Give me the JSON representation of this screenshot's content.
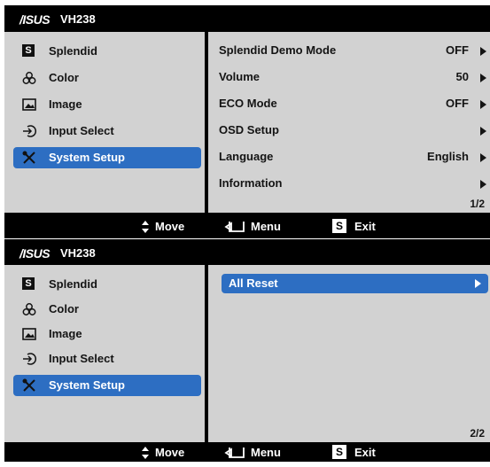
{
  "osd": [
    {
      "brand": "/ISUS",
      "model": "VH238",
      "sidebar": [
        {
          "label": "Splendid",
          "icon": "splendid-s-icon"
        },
        {
          "label": "Color",
          "icon": "color-circles-icon"
        },
        {
          "label": "Image",
          "icon": "image-icon"
        },
        {
          "label": "Input Select",
          "icon": "input-arrow-icon"
        },
        {
          "label": "System Setup",
          "icon": "wrench-screwdriver-icon",
          "selected": true
        }
      ],
      "rows": [
        {
          "label": "Splendid Demo Mode",
          "value": "OFF"
        },
        {
          "label": "Volume",
          "value": "50"
        },
        {
          "label": "ECO Mode",
          "value": "OFF"
        },
        {
          "label": "OSD Setup",
          "value": ""
        },
        {
          "label": "Language",
          "value": "English"
        },
        {
          "label": "Information",
          "value": ""
        }
      ],
      "page": "1/2",
      "footer": {
        "move": "Move",
        "menu": "Menu",
        "exit": "Exit",
        "exit_icon_letter": "S"
      }
    },
    {
      "brand": "/ISUS",
      "model": "VH238",
      "sidebar": [
        {
          "label": "Splendid",
          "icon": "splendid-s-icon"
        },
        {
          "label": "Color",
          "icon": "color-circles-icon"
        },
        {
          "label": "Image",
          "icon": "image-icon"
        },
        {
          "label": "Input Select",
          "icon": "input-arrow-icon"
        },
        {
          "label": "System Setup",
          "icon": "wrench-screwdriver-icon",
          "selected": true
        }
      ],
      "rows": [
        {
          "label": "All Reset",
          "value": "",
          "selected": true
        }
      ],
      "page": "2/2",
      "footer": {
        "move": "Move",
        "menu": "Menu",
        "exit": "Exit",
        "exit_icon_letter": "S"
      }
    }
  ],
  "colors": {
    "highlight": "#2d6ec2",
    "panel": "#d2d2d2",
    "frame": "#000000"
  }
}
